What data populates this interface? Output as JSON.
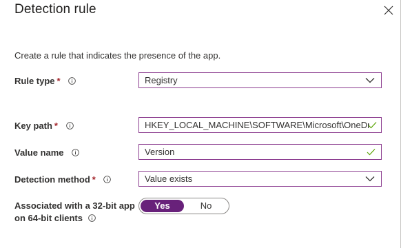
{
  "panel": {
    "title": "Detection rule",
    "intro": "Create a rule that indicates the presence of the app."
  },
  "rule_type": {
    "label": "Rule type",
    "required_mark": "*",
    "value": "Registry"
  },
  "key_path": {
    "label": "Key path",
    "required_mark": "*",
    "value": "HKEY_LOCAL_MACHINE\\SOFTWARE\\Microsoft\\OneDrive",
    "valid": true
  },
  "value_name": {
    "label": "Value name",
    "value": "Version",
    "valid": true
  },
  "detection_method": {
    "label": "Detection method",
    "required_mark": "*",
    "value": "Value exists"
  },
  "associated_32bit": {
    "label_line1": "Associated with a 32-bit app",
    "label_line2": "on 64-bit clients",
    "options": [
      "Yes",
      "No"
    ],
    "selected": "Yes"
  },
  "colors": {
    "accent": "#68217a",
    "field_border": "#8a3a8e",
    "required": "#a4262c",
    "valid_check": "#57a300"
  },
  "icons": {
    "close": "close-icon",
    "info": "info-icon",
    "chevron": "chevron-down-icon",
    "check": "checkmark-icon"
  }
}
